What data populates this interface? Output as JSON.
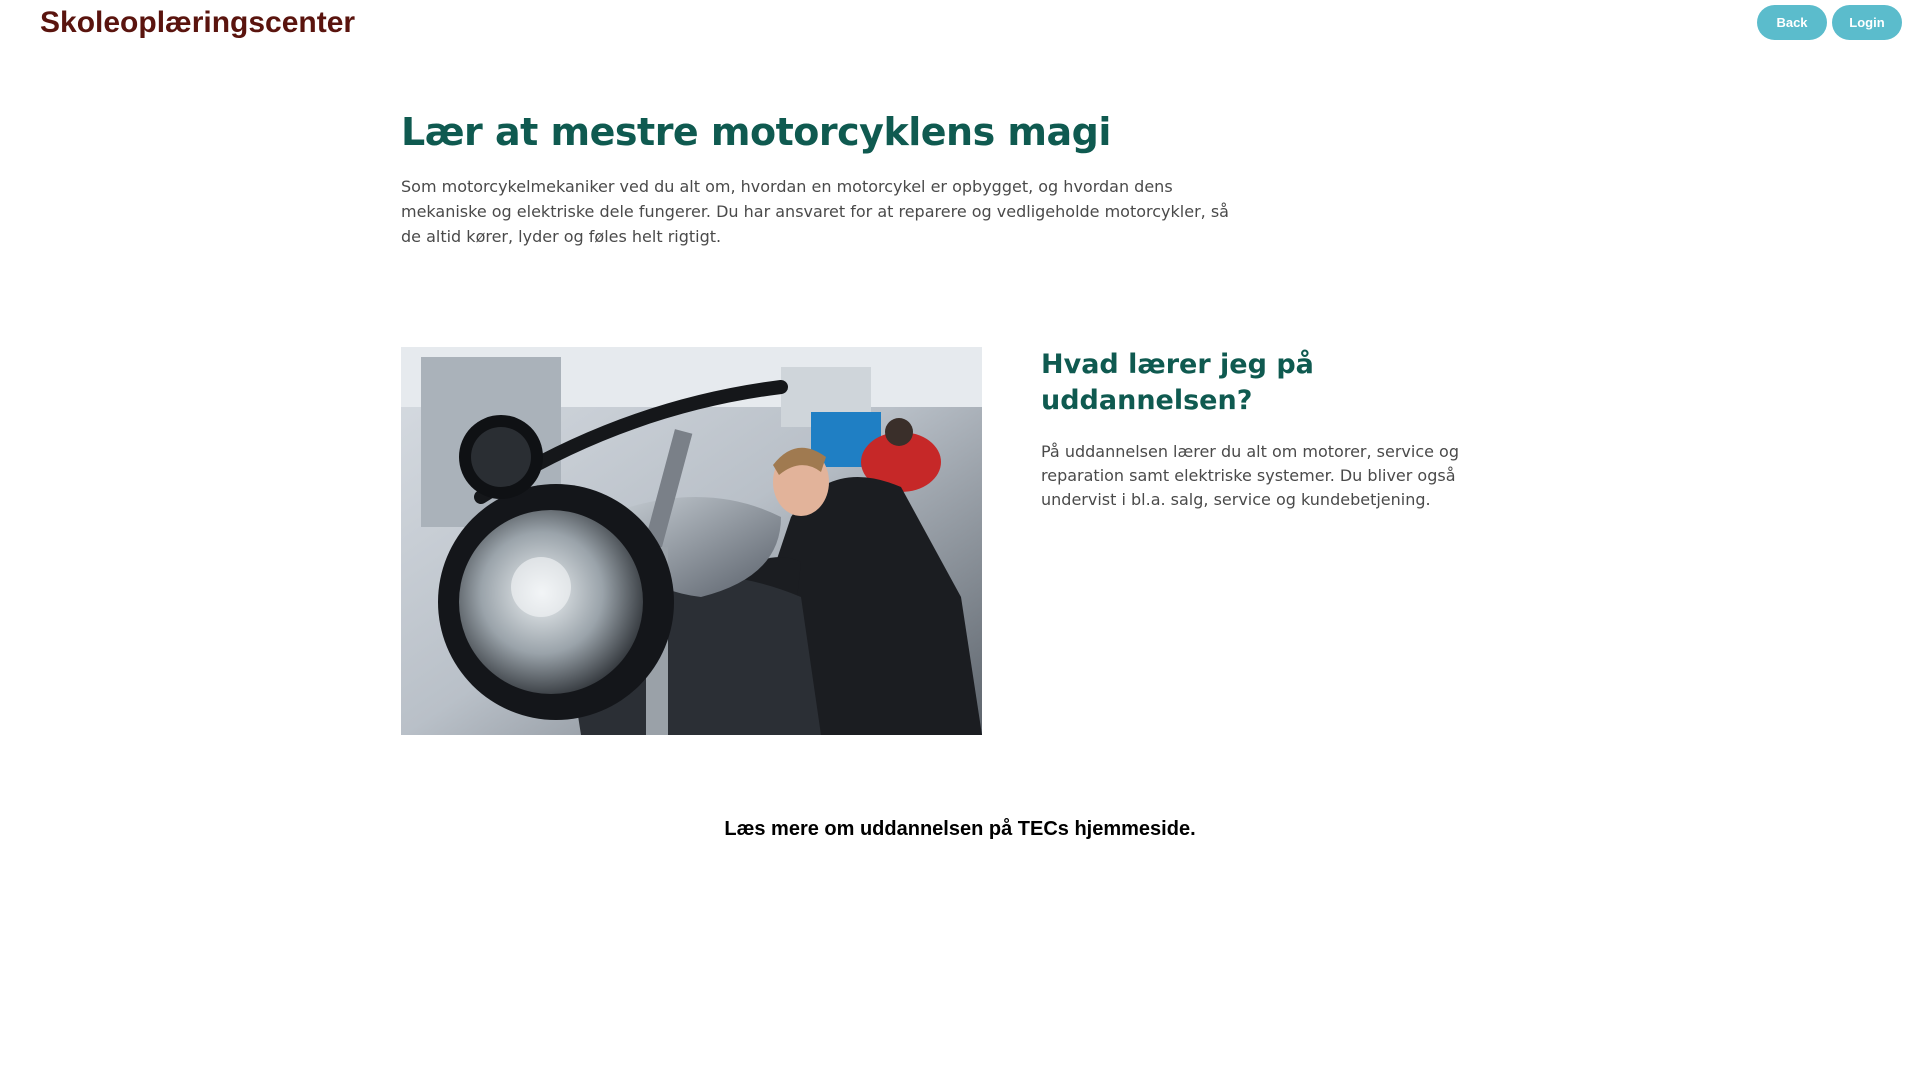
{
  "header": {
    "site_title": "Skoleoplæringscenter",
    "back_label": "Back",
    "login_label": "Login"
  },
  "hero": {
    "heading": "Lær at mestre motorcyklens magi",
    "text": "Som motorcykelmekaniker ved du alt om, hvordan en motorcykel er opbygget, og hvordan dens mekaniske og elektriske dele fungerer. Du har ansvaret for at reparere og vedligeholde motorcykler, så de altid kører, lyder og føles helt rigtigt."
  },
  "feature": {
    "heading": "Hvad lærer jeg på uddannelsen?",
    "text": "På uddannelsen lærer du alt om motorer, service og reparation samt elektriske systemer. Du bliver også undervist i bl.a. salg, service og kundebetjening."
  },
  "footer": {
    "prefix": "Læs mere om uddannelsen på ",
    "link_text": "TECs hjemmeside",
    "suffix": "."
  },
  "colors": {
    "brand": "#5a140e",
    "heading": "#0f5a50",
    "button": "#5bbccc"
  }
}
